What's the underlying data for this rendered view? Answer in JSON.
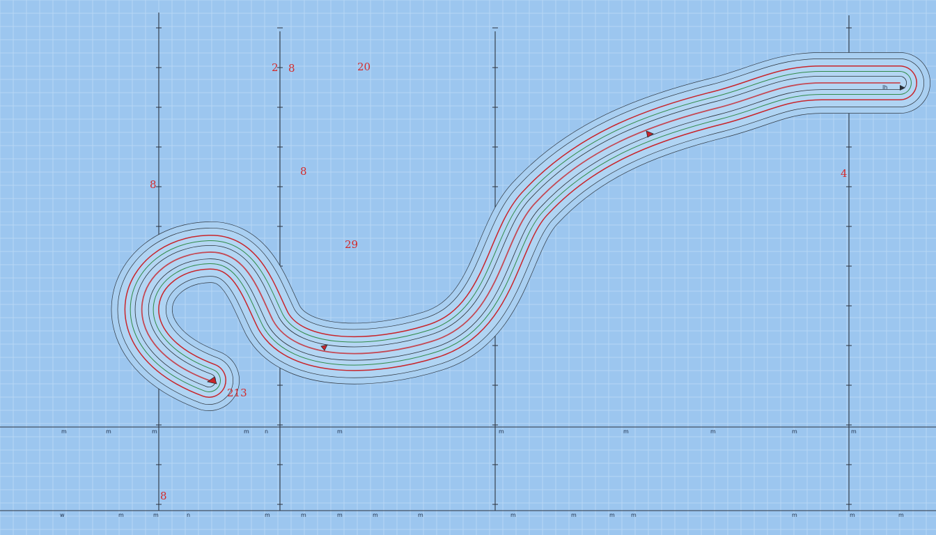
{
  "colors": {
    "background": "#9cc6ef",
    "grid_minor": "#b6d7f4",
    "grid_major": "#2d3440",
    "track_red": "#c8242a",
    "track_green": "#2f8a48",
    "track_black": "#2a3038",
    "glow": "#e4f2fc",
    "label_red": "#d42a2a"
  },
  "labels": {
    "top_2": "2",
    "top_8": "8",
    "top_20": "20",
    "mid_8": "8",
    "mid_29": "29",
    "left_8": "8",
    "right_4": "4",
    "bottom_213": "213",
    "bottom_left_8": "8"
  },
  "axis_marks": {
    "row_upper": [
      "m",
      "m",
      "m",
      "m",
      "n",
      "m",
      "m",
      "m",
      "m",
      "m",
      "m"
    ],
    "row_lower": [
      "w",
      "m",
      "m",
      "n",
      "m",
      "m",
      "m",
      "m",
      "m",
      "m",
      "m",
      "m",
      "m",
      "m",
      "m",
      "m"
    ],
    "far_right_glyph": "Ih"
  }
}
